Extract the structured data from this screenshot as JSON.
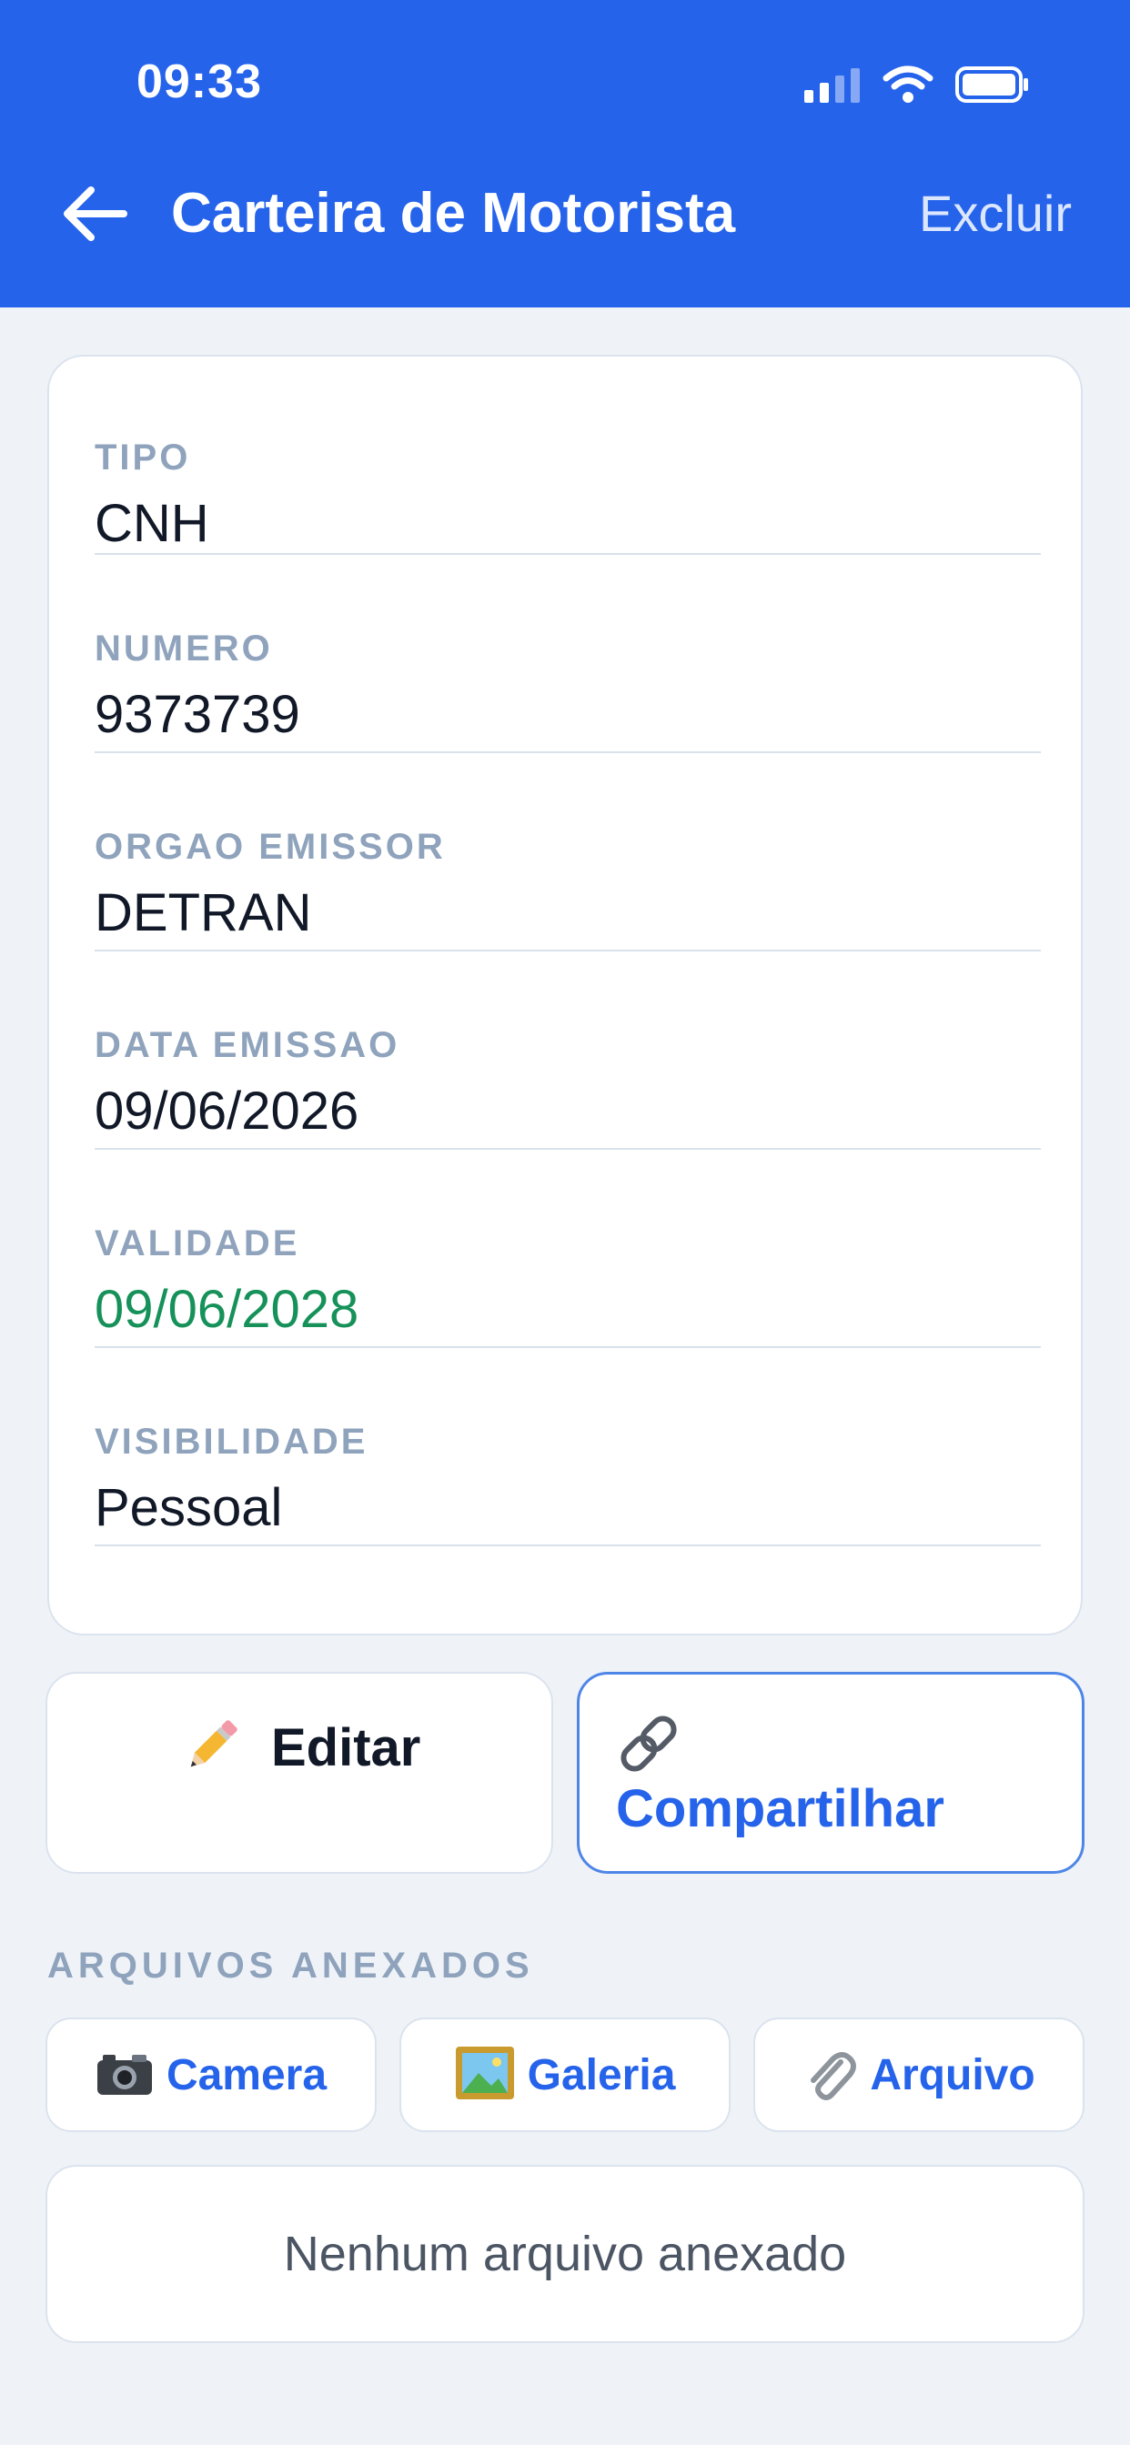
{
  "status_bar": {
    "time": "09:33"
  },
  "header": {
    "title": "Carteira de Motorista",
    "delete_label": "Excluir"
  },
  "fields": [
    {
      "label": "TIPO",
      "value": "CNH"
    },
    {
      "label": "NUMERO",
      "value": "9373739"
    },
    {
      "label": "ORGAO EMISSOR",
      "value": "DETRAN"
    },
    {
      "label": "DATA EMISSAO",
      "value": "09/06/2026"
    },
    {
      "label": "VALIDADE",
      "value": "09/06/2028"
    },
    {
      "label": "VISIBILIDADE",
      "value": "Pessoal"
    }
  ],
  "actions": {
    "edit_label": "Editar",
    "share_label": "Compartilhar"
  },
  "attachments": {
    "section_title": "ARQUIVOS ANEXADOS",
    "camera_label": "Camera",
    "gallery_label": "Galeria",
    "file_label": "Arquivo",
    "empty_text": "Nenhum arquivo anexado"
  },
  "colors": {
    "header_blue": "#2563eb",
    "validity_green": "#159159",
    "label_gray": "#8fa3bc"
  }
}
